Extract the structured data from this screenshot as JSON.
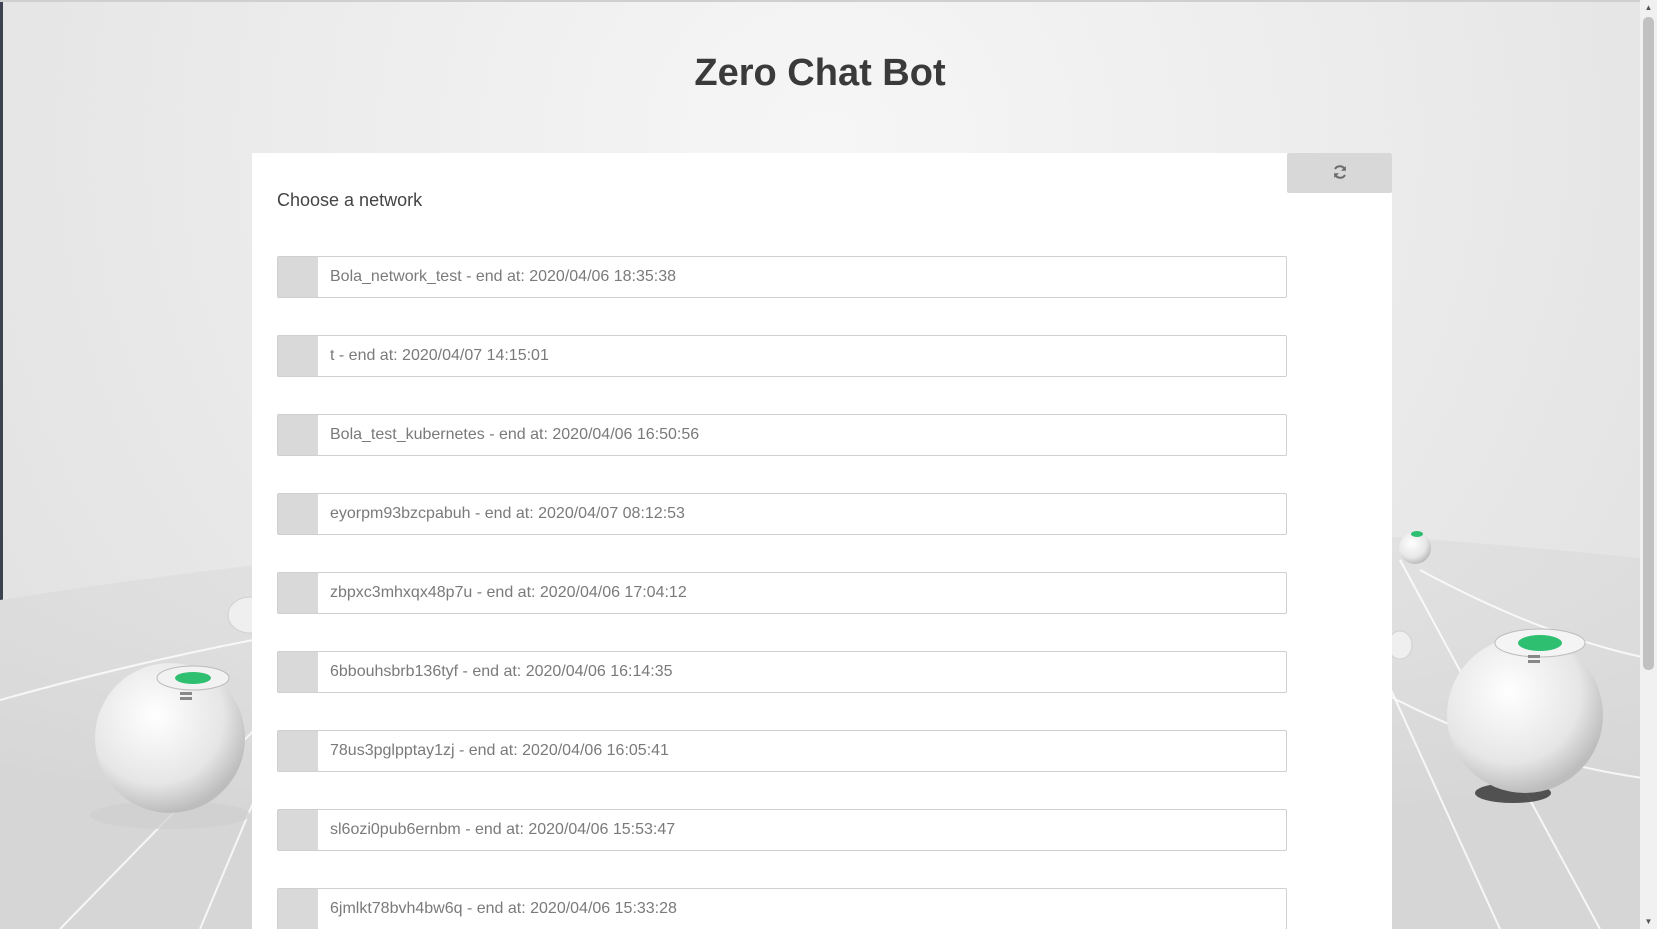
{
  "app": {
    "title": "Zero Chat Bot"
  },
  "panel": {
    "heading": "Choose a network",
    "refresh_icon": "refresh-icon"
  },
  "networks": [
    {
      "label": "Bola_network_test - end at: 2020/04/06 18:35:38"
    },
    {
      "label": "t - end at: 2020/04/07 14:15:01"
    },
    {
      "label": "Bola_test_kubernetes - end at: 2020/04/06 16:50:56"
    },
    {
      "label": "eyorpm93bzcpabuh - end at: 2020/04/07 08:12:53"
    },
    {
      "label": "zbpxc3mhxqx48p7u - end at: 2020/04/06 17:04:12"
    },
    {
      "label": "6bbouhsbrb136tyf - end at: 2020/04/06 16:14:35"
    },
    {
      "label": "78us3pglpptay1zj - end at: 2020/04/06 16:05:41"
    },
    {
      "label": "sl6ozi0pub6ernbm - end at: 2020/04/06 15:53:47"
    },
    {
      "label": "6jmlkt78bvh4bw6q - end at: 2020/04/06 15:33:28"
    }
  ],
  "colors": {
    "accent": "#2fbf71",
    "card": "#ffffff",
    "item_border": "#cfcfcf"
  }
}
